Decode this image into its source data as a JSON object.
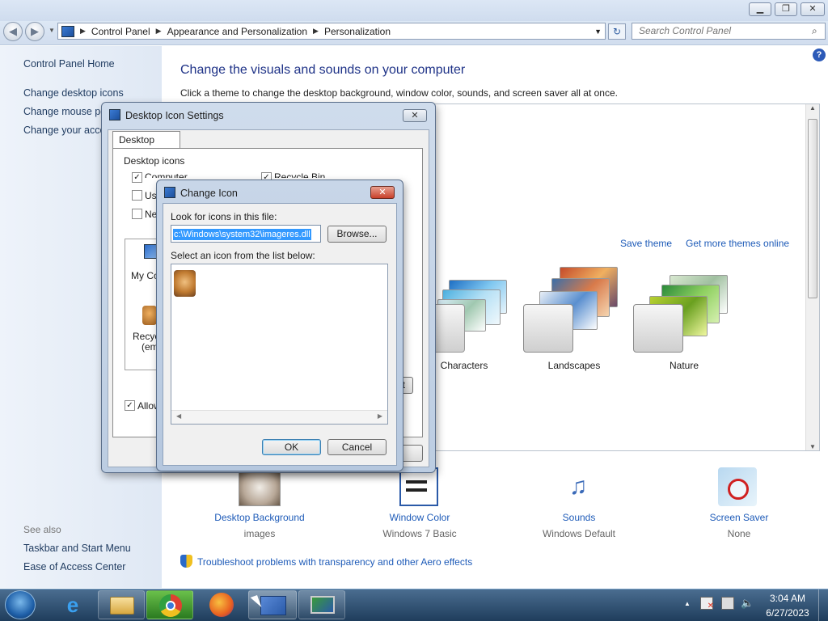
{
  "window": {
    "minimize_icon": "minimize-icon",
    "maximize_icon": "restore-icon",
    "close_icon": "close-icon"
  },
  "address": {
    "crumbs": [
      "Control Panel",
      "Appearance and Personalization",
      "Personalization"
    ],
    "search_placeholder": "Search Control Panel"
  },
  "sidebar": {
    "items": [
      "Control Panel Home",
      "Change desktop icons",
      "Change mouse po",
      "Change your acco"
    ],
    "see_also_title": "See also",
    "see_also": [
      "Taskbar and Start Menu",
      "Ease of Access Center"
    ]
  },
  "main": {
    "title": "Change the visuals and sounds on your computer",
    "subtitle": "Click a theme to change the desktop background, window color, sounds, and screen saver all at once.",
    "save_theme": "Save theme",
    "more_themes": "Get more themes online",
    "themes": [
      "Characters",
      "Landscapes",
      "Nature"
    ],
    "bottom": [
      {
        "label": "Desktop Background",
        "sub": "images"
      },
      {
        "label": "Window Color",
        "sub": "Windows 7 Basic"
      },
      {
        "label": "Sounds",
        "sub": "Windows Default"
      },
      {
        "label": "Screen Saver",
        "sub": "None"
      }
    ],
    "troubleshoot": "Troubleshoot problems with transparency and other Aero effects"
  },
  "desktop_icon_dialog": {
    "title": "Desktop Icon Settings",
    "tab": "Desktop Icons",
    "group_title": "Desktop icons",
    "checkboxes": [
      {
        "label": "Computer",
        "checked": true
      },
      {
        "label": "Recycle Bin",
        "checked": true
      },
      {
        "label": "Use",
        "checked": false
      },
      {
        "label": "Ne",
        "checked": false
      }
    ],
    "icon_labels": [
      "My Co",
      "Recyc",
      "(emp"
    ],
    "allow_label": "Allow",
    "partial_button": "lt"
  },
  "change_icon_dialog": {
    "title": "Change Icon",
    "look_label": "Look for icons in this file:",
    "file_value": "c:\\Windows\\system32\\imageres.dll",
    "browse": "Browse...",
    "select_label": "Select an icon from the list below:",
    "ok": "OK",
    "cancel": "Cancel"
  },
  "taskbar": {
    "time": "3:04 AM",
    "date": "6/27/2023",
    "items": [
      "start-orb-icon",
      "internet-explorer-icon",
      "file-explorer-icon",
      "chrome-icon",
      "firefox-icon",
      "control-panel-icon",
      "display-settings-icon"
    ]
  }
}
